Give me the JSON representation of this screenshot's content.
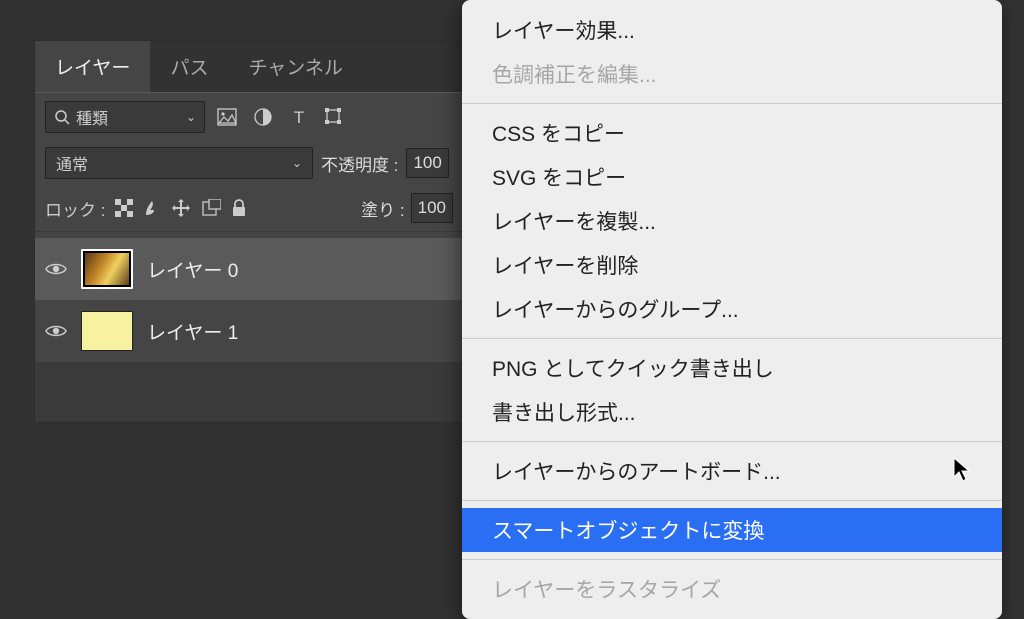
{
  "tabs": {
    "layers": "レイヤー",
    "paths": "パス",
    "channels": "チャンネル"
  },
  "filter": {
    "label": "種類"
  },
  "blend": {
    "mode": "通常",
    "opacity_label": "不透明度 :",
    "opacity_value": "100"
  },
  "lock": {
    "label": "ロック :",
    "fill_label": "塗り :",
    "fill_value": "100"
  },
  "layers": [
    {
      "name": "レイヤー 0"
    },
    {
      "name": "レイヤー 1"
    }
  ],
  "menu": {
    "items": [
      {
        "label": "レイヤー効果...",
        "disabled": false
      },
      {
        "label": "色調補正を編集...",
        "disabled": true
      },
      "sep",
      {
        "label": "CSS をコピー",
        "disabled": false
      },
      {
        "label": "SVG をコピー",
        "disabled": false
      },
      {
        "label": "レイヤーを複製...",
        "disabled": false
      },
      {
        "label": "レイヤーを削除",
        "disabled": false
      },
      {
        "label": "レイヤーからのグループ...",
        "disabled": false
      },
      "sep",
      {
        "label": "PNG としてクイック書き出し",
        "disabled": false
      },
      {
        "label": "書き出し形式...",
        "disabled": false
      },
      "sep",
      {
        "label": "レイヤーからのアートボード...",
        "disabled": false
      },
      "sep",
      {
        "label": "スマートオブジェクトに変換",
        "disabled": false,
        "highlighted": true
      },
      "sep",
      {
        "label": "レイヤーをラスタライズ",
        "disabled": true
      }
    ]
  }
}
